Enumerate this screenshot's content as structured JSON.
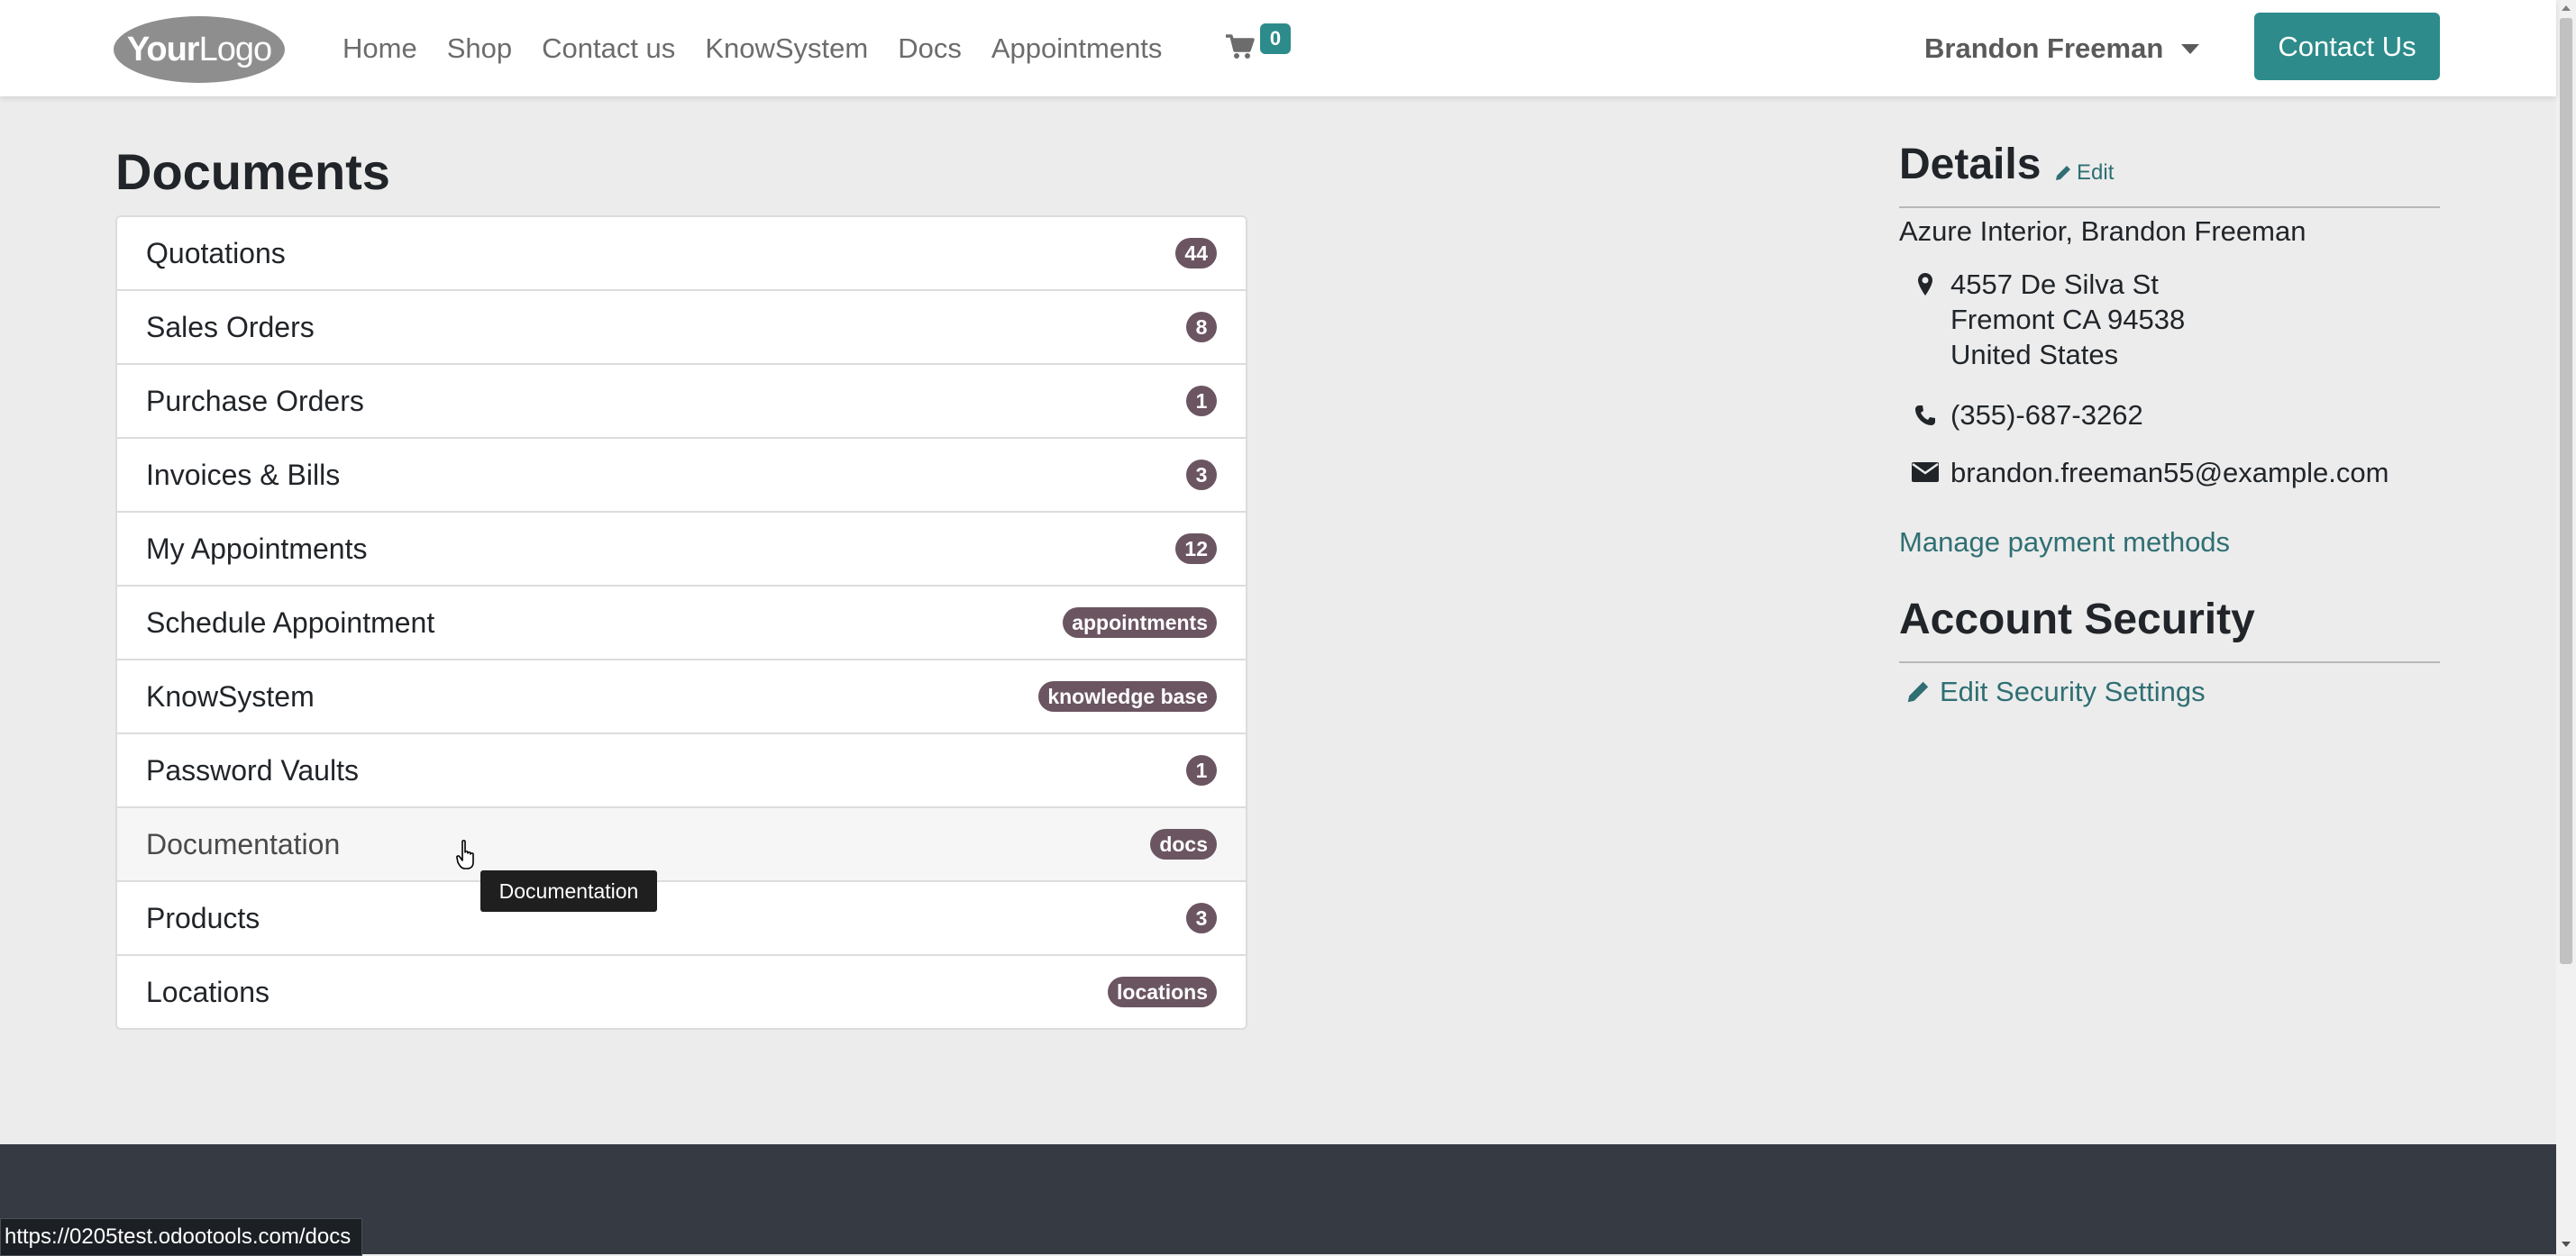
{
  "header": {
    "logo": {
      "text_bold": "Your",
      "text_light": "Logo"
    },
    "nav": [
      "Home",
      "Shop",
      "Contact us",
      "KnowSystem",
      "Docs",
      "Appointments"
    ],
    "cart": {
      "icon": "shopping-cart-icon",
      "count": "0"
    },
    "user": {
      "name": "Brandon Freeman"
    },
    "contact_button": "Contact Us"
  },
  "documents": {
    "title": "Documents",
    "items": [
      {
        "label": "Quotations",
        "badge": "44"
      },
      {
        "label": "Sales Orders",
        "badge": "8"
      },
      {
        "label": "Purchase Orders",
        "badge": "1"
      },
      {
        "label": "Invoices & Bills",
        "badge": "3"
      },
      {
        "label": "My Appointments",
        "badge": "12"
      },
      {
        "label": "Schedule Appointment",
        "badge": "appointments"
      },
      {
        "label": "KnowSystem",
        "badge": "knowledge base"
      },
      {
        "label": "Password Vaults",
        "badge": "1"
      },
      {
        "label": "Documentation",
        "badge": "docs"
      },
      {
        "label": "Products",
        "badge": "3"
      },
      {
        "label": "Locations",
        "badge": "locations"
      }
    ],
    "tooltip": "Documentation"
  },
  "details": {
    "title": "Details",
    "edit_label": "Edit",
    "company": "Azure Interior, Brandon Freeman",
    "address": [
      "4557 De Silva St",
      "Fremont CA 94538",
      "United States"
    ],
    "phone": "(355)-687-3262",
    "email": "brandon.freeman55@example.com",
    "manage_payment": "Manage payment methods"
  },
  "security": {
    "title": "Account Security",
    "edit_settings": "Edit Security Settings"
  },
  "status_url": "https://0205test.odootools.com/docs",
  "colors": {
    "accent": "#2e8b8b",
    "link": "#2f6f73",
    "badge": "#6b5561",
    "footer": "#363b43",
    "page_bg": "#ececec"
  }
}
